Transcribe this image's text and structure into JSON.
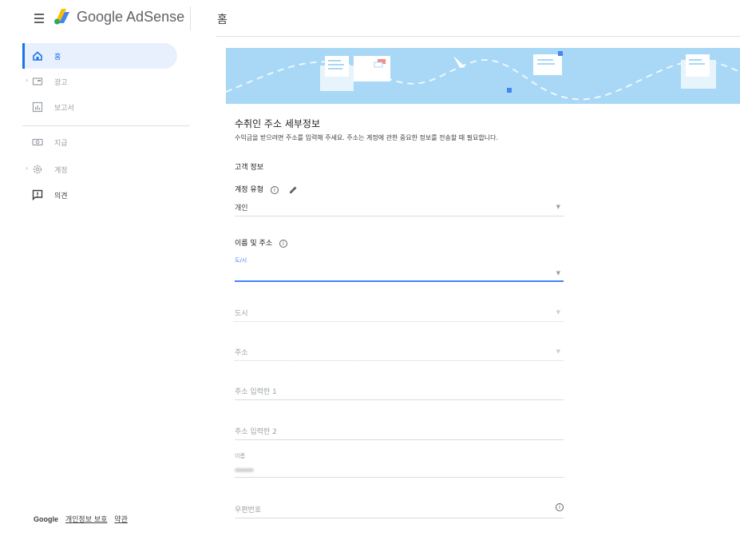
{
  "header": {
    "app_name": "Google AdSense",
    "page_title": "홈"
  },
  "sidebar": {
    "items": [
      {
        "label": "홈",
        "icon": "home-icon",
        "active": true
      },
      {
        "label": "광고",
        "icon": "ads-icon",
        "expandable": true
      },
      {
        "label": "보고서",
        "icon": "reports-icon"
      },
      {
        "label": "지급",
        "icon": "payments-icon"
      },
      {
        "label": "계정",
        "icon": "settings-icon",
        "expandable": true
      },
      {
        "label": "의견",
        "icon": "feedback-icon"
      }
    ],
    "footer": {
      "brand": "Google",
      "privacy": "개인정보 보호",
      "terms": "약관"
    }
  },
  "card": {
    "title": "수취인 주소 세부정보",
    "description": "수익금을 받으려면 주소를 입력해 주세요. 주소는 계정에 관한 중요한 정보를 전송할 때 필요합니다.",
    "customer_info_heading": "고객 정보",
    "account_type": {
      "label": "계정 유형",
      "value": "개인"
    },
    "name_address_heading": "이름 및 주소",
    "fields": {
      "province": {
        "label": "도/시",
        "value": ""
      },
      "city": {
        "placeholder": "도시"
      },
      "address": {
        "placeholder": "주소"
      },
      "address_line1": {
        "placeholder": "주소 입력란 1"
      },
      "address_line2": {
        "placeholder": "주소 입력란 2"
      },
      "name": {
        "label": "이름"
      },
      "postal_code": {
        "placeholder": "우편번호"
      }
    }
  },
  "colors": {
    "accent": "#1a73e8",
    "banner": "#a8d8f6",
    "active_bg": "#e8f0fe"
  }
}
